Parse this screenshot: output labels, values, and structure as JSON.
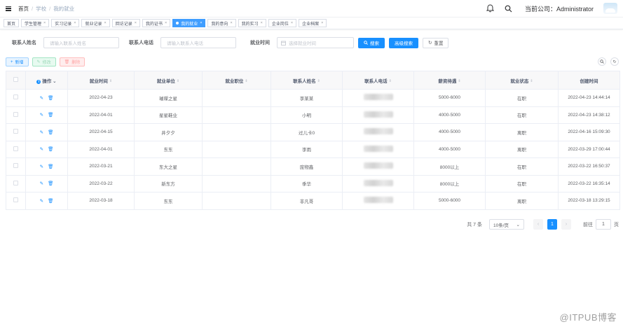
{
  "breadcrumb": [
    "首页",
    "学校",
    "我的就业"
  ],
  "header": {
    "company": "当前公司：Administrator"
  },
  "tabs": [
    {
      "label": "首页",
      "closable": false
    },
    {
      "label": "学生管理",
      "closable": true
    },
    {
      "label": "实习记录",
      "closable": true
    },
    {
      "label": "就业记录",
      "closable": true
    },
    {
      "label": "回访记录",
      "closable": true
    },
    {
      "label": "我的证书",
      "closable": true
    },
    {
      "label": "我的就业",
      "closable": true,
      "active": true
    },
    {
      "label": "我的意向",
      "closable": true
    },
    {
      "label": "我的实习",
      "closable": true
    },
    {
      "label": "企业岗位",
      "closable": true
    },
    {
      "label": "企业档案",
      "closable": true
    }
  ],
  "search": {
    "name_label": "联系人姓名",
    "name_placeholder": "请输入联系人姓名",
    "phone_label": "联系人电话",
    "phone_placeholder": "请输入联系人电话",
    "time_label": "就业时间",
    "time_placeholder": "选择就业时间",
    "search_btn": "搜索",
    "advanced_btn": "高级搜索",
    "reset_btn": "重置"
  },
  "toolbar": {
    "add": "新增",
    "edit": "修改",
    "delete": "删除"
  },
  "table": {
    "headers": [
      "操作",
      "就业时间",
      "就业单位",
      "就业职位",
      "联系人姓名",
      "联系人电话",
      "薪资待遇",
      "就业状态",
      "创建时间"
    ],
    "rows": [
      {
        "date": "2022-04-23",
        "unit": "璀璨之星",
        "position": "",
        "name": "李某某",
        "salary": "5000-6000",
        "status": "在职",
        "created": "2022-04-23 14:44:14"
      },
      {
        "date": "2022-04-01",
        "unit": "星星鞋业",
        "position": "",
        "name": "小明",
        "salary": "4000-5000",
        "status": "在职",
        "created": "2022-04-23 14:38:12"
      },
      {
        "date": "2022-04-15",
        "unit": "井夕夕",
        "position": "",
        "name": "过儿卡0",
        "salary": "4000-5000",
        "status": "离职",
        "created": "2022-04-16 15:09:30"
      },
      {
        "date": "2022-04-01",
        "unit": "东东",
        "position": "",
        "name": "李雨",
        "salary": "4000-5000",
        "status": "离职",
        "created": "2022-03-29 17:00:44"
      },
      {
        "date": "2022-03-21",
        "unit": "东大之星",
        "position": "",
        "name": "庞物鑫",
        "salary": "8000以上",
        "status": "在职",
        "created": "2022-03-22 16:50:37"
      },
      {
        "date": "2022-03-22",
        "unit": "新东方",
        "position": "",
        "name": "季华",
        "salary": "8000以上",
        "status": "在职",
        "created": "2022-03-22 16:35:14"
      },
      {
        "date": "2022-03-18",
        "unit": "东东",
        "position": "",
        "name": "非凡哥",
        "salary": "5000-6000",
        "status": "离职",
        "created": "2022-03-18 13:29:15"
      }
    ]
  },
  "pager": {
    "total": "共 7 条",
    "size": "10条/页",
    "current": "1",
    "goto_prefix": "前往",
    "goto_value": "1",
    "goto_suffix": "页"
  },
  "watermark": "@ITPUB博客"
}
